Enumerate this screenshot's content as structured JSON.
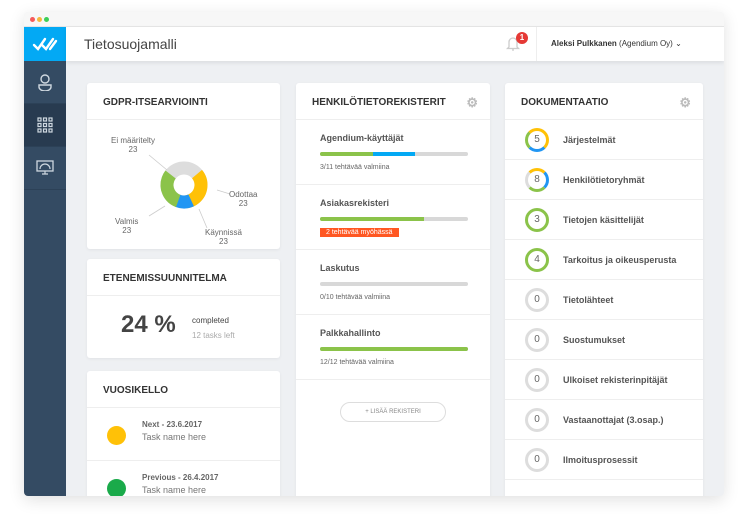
{
  "app": {
    "title": "Tietosuojamalli"
  },
  "header": {
    "notifications": "1",
    "user_name": "Aleksi Pulkkanen",
    "user_org": "(Agendium Oy)"
  },
  "colors": {
    "brand": "#03a9f4",
    "sidebar": "#344b63",
    "green": "#8bc34a",
    "blue": "#2196f3",
    "yellow": "#ffc107",
    "grey": "#dddddd",
    "red": "#ff5722"
  },
  "gdpr": {
    "title": "GDPR-ITSEARVIOINTI",
    "segments": [
      {
        "label": "Ei määritelty",
        "value": "23"
      },
      {
        "label": "Odottaa",
        "value": "23"
      },
      {
        "label": "Käynnissä",
        "value": "23"
      },
      {
        "label": "Valmis",
        "value": "23"
      }
    ]
  },
  "plan": {
    "title": "ETENEMISSUUNNITELMA",
    "percent": "24 %",
    "completed": "completed",
    "left": "12 tasks left"
  },
  "vuosikello": {
    "title": "VUOSIKELLO",
    "items": [
      {
        "kind": "Next",
        "date": "- 23.6.2017",
        "task": "Task name here",
        "color": "#ffc107"
      },
      {
        "kind": "Previous",
        "date": "- 26.4.2017",
        "task": "Task name here",
        "color": "#1aaa4a"
      }
    ]
  },
  "registers": {
    "title": "HENKILÖTIETOREKISTERIT",
    "add": "+ LISÄÄ REKISTERI",
    "items": [
      {
        "name": "Agendium-käyttäjät",
        "status": "3/11 tehtävää valmiina",
        "green": 36,
        "blue": 28,
        "late": false
      },
      {
        "name": "Asiakasrekisteri",
        "status": "2 tehtävää myöhässä",
        "green": 70,
        "blue": 0,
        "late": true
      },
      {
        "name": "Laskutus",
        "status": "0/10 tehtävää valmiina",
        "green": 0,
        "blue": 0,
        "late": false
      },
      {
        "name": "Palkkahallinto",
        "status": "12/12 tehtävää valmiina",
        "green": 100,
        "blue": 0,
        "late": false
      }
    ]
  },
  "docs": {
    "title": "DOKUMENTAATIO",
    "items": [
      {
        "count": "5",
        "name": "Järjestelmät",
        "ring": "mixed"
      },
      {
        "count": "8",
        "name": "Henkilötietoryhmät",
        "ring": "mixed2"
      },
      {
        "count": "3",
        "name": "Tietojen käsittelijät",
        "ring": "green"
      },
      {
        "count": "4",
        "name": "Tarkoitus ja oikeusperusta",
        "ring": "green"
      },
      {
        "count": "0",
        "name": "Tietolähteet",
        "ring": "grey"
      },
      {
        "count": "0",
        "name": "Suostumukset",
        "ring": "grey"
      },
      {
        "count": "0",
        "name": "Ulkoiset rekisterinpitäjät",
        "ring": "grey"
      },
      {
        "count": "0",
        "name": "Vastaanottajat (3.osap.)",
        "ring": "grey"
      },
      {
        "count": "0",
        "name": "Ilmoitusprosessit",
        "ring": "grey"
      }
    ]
  }
}
